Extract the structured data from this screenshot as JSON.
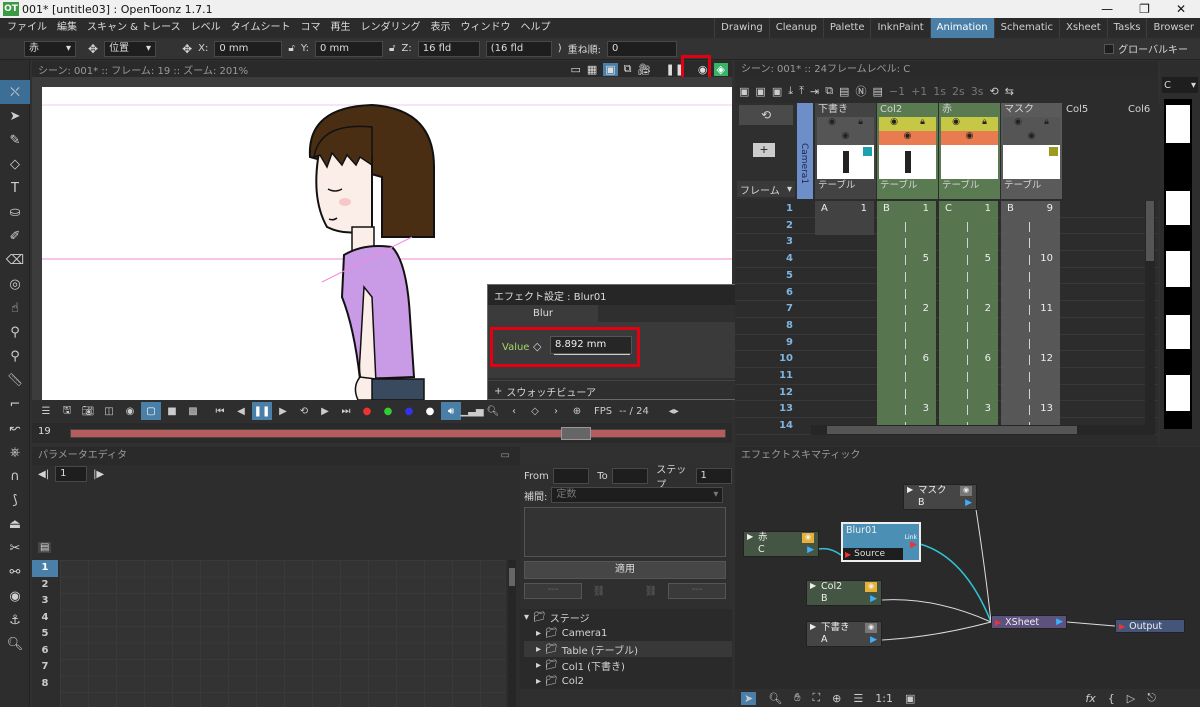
{
  "app": {
    "title": "001* [untitle03] : OpenToonz 1.7.1",
    "logo": "OT"
  },
  "menu": [
    "ファイル",
    "編集",
    "スキャン & トレース",
    "レベル",
    "タイムシート",
    "コマ",
    "再生",
    "レンダリング",
    "表示",
    "ウィンドウ",
    "ヘルプ"
  ],
  "rooms": [
    "Drawing",
    "Cleanup",
    "Palette",
    "InknPaint",
    "Animation",
    "Schematic",
    "Xsheet",
    "Tasks",
    "Browser"
  ],
  "active_room": "Animation",
  "tool_options": {
    "object": "赤",
    "mode": "位置",
    "x_label": "X:",
    "x_value": "0 mm",
    "y_label": "Y:",
    "y_value": "0 mm",
    "z_label": "Z:",
    "z_value": "16 fld",
    "so_value": "(16 fld",
    "so_suffix": ")",
    "order_label": "重ね順:",
    "order_value": "0",
    "global_key": "グローバルキー"
  },
  "viewer": {
    "header": "シーン: 001*  ::  フレーム: 19  ::  ズーム: 201%",
    "frame_field": "19",
    "fps_label": "FPS",
    "fps_value": "-- / 24"
  },
  "effect_dialog": {
    "title": "エフェクト設定 : Blur01",
    "tab": "Blur",
    "param_label": "Value",
    "param_value": "8.892 mm",
    "swatch": "スウォッチビューア"
  },
  "xsheet": {
    "header": "シーン: 001*  ::  24フレームレベル: C",
    "camera": "Camera1",
    "frame_label": "フレーム",
    "columns": [
      {
        "name": "下書き",
        "pegbar": "テーブル",
        "color": "#434343"
      },
      {
        "name": "Col2",
        "pegbar": "テーブル",
        "color": "#5a7a52"
      },
      {
        "name": "赤",
        "pegbar": "テーブル",
        "color": "#5a7a52"
      },
      {
        "name": "マスク",
        "pegbar": "テーブル",
        "color": "#5a5a5a"
      },
      {
        "name": "Col5",
        "pegbar": "",
        "color": "#2c2c2c"
      },
      {
        "name": "Col6",
        "pegbar": "",
        "color": "#2c2c2c"
      }
    ],
    "rows": [
      "1",
      "2",
      "3",
      "4",
      "5",
      "6",
      "7",
      "8",
      "9",
      "10",
      "11",
      "12",
      "13",
      "14"
    ],
    "cells": {
      "c1": [
        {
          "r": 0,
          "t": "A"
        },
        {
          "r": 0,
          "n": "1"
        }
      ],
      "c2": [
        {
          "r": 0,
          "t": "B"
        },
        {
          "r": 0,
          "n": "1"
        },
        {
          "r": 3,
          "n": "5"
        },
        {
          "r": 6,
          "n": "2"
        },
        {
          "r": 9,
          "n": "6"
        },
        {
          "r": 12,
          "n": "3"
        }
      ],
      "c3": [
        {
          "r": 0,
          "t": "C"
        },
        {
          "r": 0,
          "n": "1"
        },
        {
          "r": 3,
          "n": "5"
        },
        {
          "r": 6,
          "n": "2"
        },
        {
          "r": 9,
          "n": "6"
        },
        {
          "r": 12,
          "n": "3"
        }
      ],
      "c4": [
        {
          "r": 0,
          "t": "B"
        },
        {
          "r": 0,
          "n": "9"
        },
        {
          "r": 3,
          "n": "10"
        },
        {
          "r": 6,
          "n": "11"
        },
        {
          "r": 9,
          "n": "12"
        },
        {
          "r": 12,
          "n": "13"
        }
      ]
    },
    "level_strip": "C"
  },
  "param_editor": {
    "title": "パラメータエディタ",
    "frame": "1",
    "from_label": "From",
    "to_label": "To",
    "step_label": "ステップ",
    "step_value": "1",
    "interp_label": "補間:",
    "interp_value": "定数",
    "apply": "適用",
    "dash1": "---",
    "dash2": "---",
    "rows": [
      "1",
      "2",
      "3",
      "4",
      "5",
      "6",
      "7",
      "8"
    ],
    "tree_root": "ステージ",
    "tree": [
      "Camera1",
      "Table (テーブル)",
      "Col1 (下書き)",
      "Col2"
    ]
  },
  "schematic": {
    "title": "エフェクトスキマティック",
    "nodes": {
      "mask": {
        "name": "マスク",
        "sub": "B"
      },
      "red": {
        "name": "赤",
        "sub": "C"
      },
      "blur": {
        "name": "Blur01",
        "port": "Source",
        "link": "Link"
      },
      "col2": {
        "name": "Col2",
        "sub": "B"
      },
      "draft": {
        "name": "下書き",
        "sub": "A"
      },
      "xsheet": {
        "name": "XSheet"
      },
      "output": {
        "name": "Output"
      }
    },
    "zoom_label": "1:1",
    "fx_label": "fx"
  },
  "colors": {
    "accent": "#4a7fa8",
    "highlight": "#e30010",
    "node_green": "#455543",
    "blur_node": "#4b8fb5",
    "xsheet_node": "#5c527d",
    "output_node": "#45557a"
  }
}
